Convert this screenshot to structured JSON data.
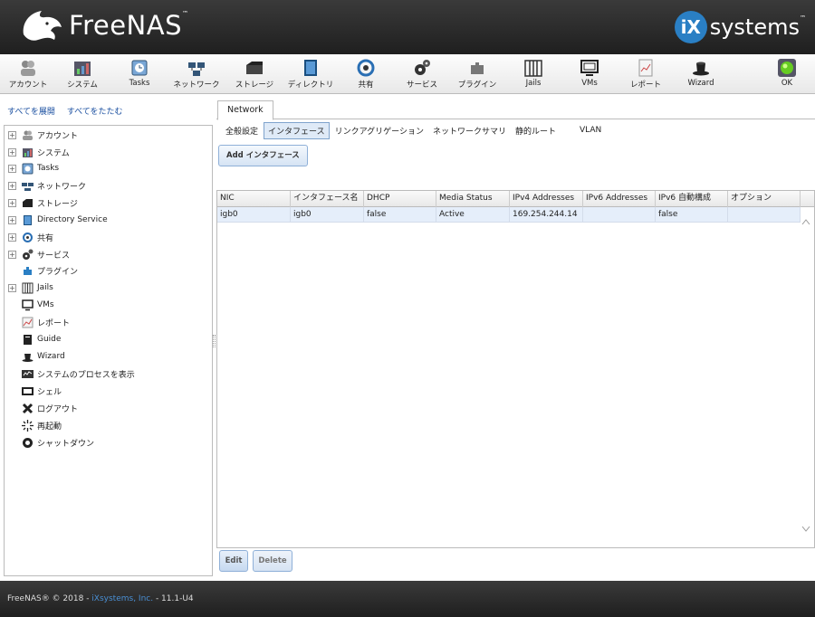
{
  "header": {
    "brand": "FreeNAS",
    "brand_tm": "™",
    "vendor_mark": "iX",
    "vendor_text": "systems",
    "vendor_tm": "™"
  },
  "toolbar": [
    {
      "label": "アカウント",
      "icon": "account-icon"
    },
    {
      "label": "システム",
      "icon": "system-icon"
    },
    {
      "label": "Tasks",
      "icon": "tasks-icon"
    },
    {
      "label": "ネットワーク",
      "icon": "network-icon"
    },
    {
      "label": "ストレージ",
      "icon": "storage-icon"
    },
    {
      "label": "ディレクトリ",
      "icon": "directory-icon"
    },
    {
      "label": "共有",
      "icon": "sharing-icon"
    },
    {
      "label": "サービス",
      "icon": "services-icon"
    },
    {
      "label": "プラグイン",
      "icon": "plugins-icon"
    },
    {
      "label": "Jails",
      "icon": "jails-icon"
    },
    {
      "label": "VMs",
      "icon": "vms-icon"
    },
    {
      "label": "レポート",
      "icon": "reporting-icon"
    },
    {
      "label": "Wizard",
      "icon": "wizard-icon"
    },
    {
      "label": "OK",
      "icon": "alert-ok-icon"
    }
  ],
  "left": {
    "expand_all": "すべてを展開",
    "collapse_all": "すべてをたたむ",
    "tree": [
      {
        "label": "アカウント",
        "expandable": true,
        "icon": "account-icon"
      },
      {
        "label": "システム",
        "expandable": true,
        "icon": "system-icon"
      },
      {
        "label": "Tasks",
        "expandable": true,
        "icon": "tasks-icon"
      },
      {
        "label": "ネットワーク",
        "expandable": true,
        "icon": "network-icon"
      },
      {
        "label": "ストレージ",
        "expandable": true,
        "icon": "storage-icon"
      },
      {
        "label": "Directory Service",
        "expandable": true,
        "icon": "directory-icon"
      },
      {
        "label": "共有",
        "expandable": true,
        "icon": "sharing-icon"
      },
      {
        "label": "サービス",
        "expandable": true,
        "icon": "services-icon"
      },
      {
        "label": "プラグイン",
        "expandable": false,
        "icon": "plugins-icon"
      },
      {
        "label": "Jails",
        "expandable": true,
        "icon": "jails-icon"
      },
      {
        "label": "VMs",
        "expandable": false,
        "icon": "vms-icon"
      },
      {
        "label": "レポート",
        "expandable": false,
        "icon": "reporting-icon"
      },
      {
        "label": "Guide",
        "expandable": false,
        "icon": "guide-icon"
      },
      {
        "label": "Wizard",
        "expandable": false,
        "icon": "wizard-icon"
      },
      {
        "label": "システムのプロセスを表示",
        "expandable": false,
        "icon": "processes-icon"
      },
      {
        "label": "シェル",
        "expandable": false,
        "icon": "shell-icon"
      },
      {
        "label": "ログアウト",
        "expandable": false,
        "icon": "logout-icon"
      },
      {
        "label": "再起動",
        "expandable": false,
        "icon": "reboot-icon"
      },
      {
        "label": "シャットダウン",
        "expandable": false,
        "icon": "shutdown-icon"
      }
    ]
  },
  "main": {
    "tab": "Network",
    "subtabs": [
      "全般設定",
      "インタフェース",
      "リンクアグリゲーション",
      "ネットワークサマリ",
      "静的ルート",
      "VLAN"
    ],
    "active_subtab": 1,
    "add_button": "Add インタフェース",
    "columns": [
      "NIC",
      "インタフェース名",
      "DHCP",
      "Media Status",
      "IPv4 Addresses",
      "IPv6 Addresses",
      "IPv6 自動構成",
      "オプション"
    ],
    "rows": [
      [
        "igb0",
        "igb0",
        "false",
        "Active",
        "169.254.244.14",
        "",
        "false",
        ""
      ]
    ],
    "edit_button": "Edit",
    "delete_button": "Delete"
  },
  "footer": {
    "prefix": "FreeNAS® © 2018 - ",
    "company": "iXsystems, Inc.",
    "suffix": " - 11.1-U4"
  },
  "colors": {
    "accent": "#2a7fc4",
    "selected_row": "#e5eefa",
    "link": "#1a4fa0"
  }
}
